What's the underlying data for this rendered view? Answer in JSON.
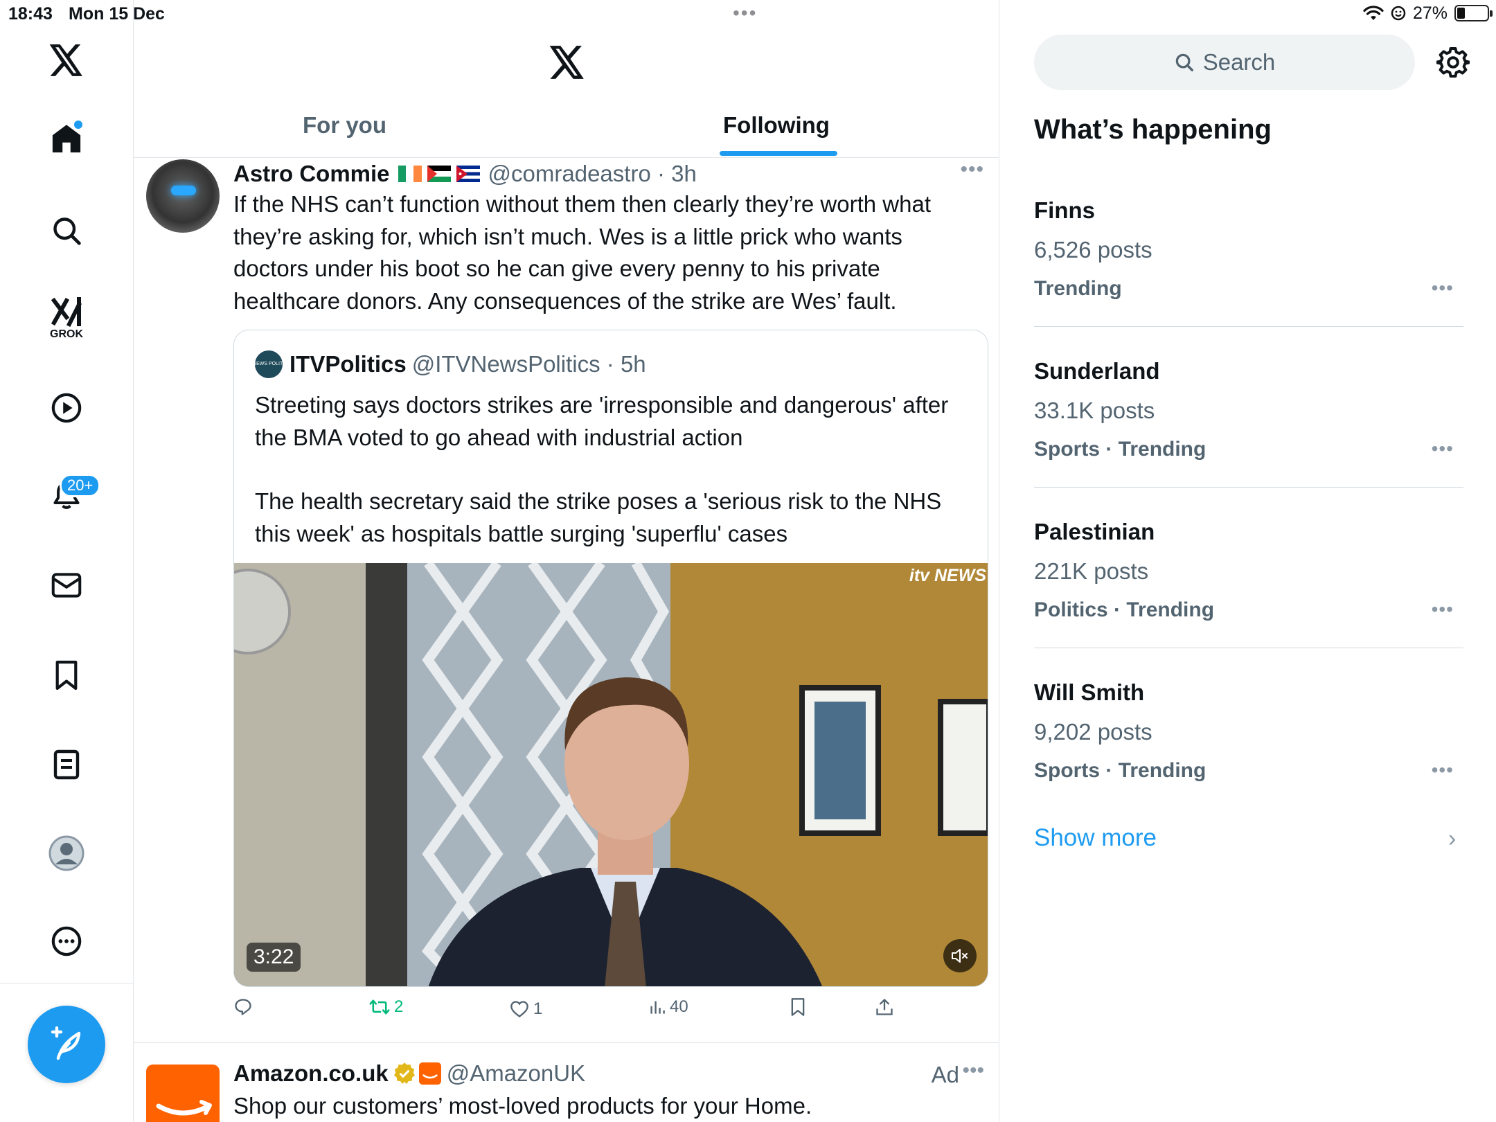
{
  "status_bar": {
    "time": "18:43",
    "date": "Mon 15 Dec",
    "battery": "27%",
    "battery_level": 0.27
  },
  "nav": {
    "items": [
      "x-logo",
      "home",
      "explore",
      "grok",
      "video",
      "notifications",
      "messages",
      "bookmarks",
      "lists",
      "profile",
      "more"
    ],
    "grok_label": "GROK",
    "notifications_badge": "20+"
  },
  "header": {
    "tabs": [
      {
        "label": "For you",
        "active": false
      },
      {
        "label": "Following",
        "active": true
      }
    ]
  },
  "tweet": {
    "name": "Astro Commie",
    "flags": [
      "Ireland",
      "Palestine",
      "Cuba"
    ],
    "handle": "@comradeastro",
    "time": "3h",
    "text": "If the NHS can’t function without them then clearly they’re worth what they’re asking for, which isn’t much. Wes is a little prick who wants doctors under his boot so he can give every penny to his private healthcare donors. Any consequences of the strike are Wes’ fault.",
    "quote": {
      "avatar_text": "itv NEWS POLITICS",
      "name": "ITVPolitics",
      "handle": "@ITVNewsPolitics",
      "time": "5h",
      "paragraphs": [
        "Streeting says doctors strikes are 'irresponsible and dangerous' after the BMA voted to go ahead with industrial action",
        "The health secretary said the strike poses a 'serious risk to the NHS this week' as hospitals battle surging 'superflu' cases"
      ],
      "video": {
        "duration": "3:22",
        "watermark": "itv NEWS",
        "muted": true
      }
    },
    "actions": {
      "replies": "",
      "retweets": "2",
      "likes": "1",
      "views": "40"
    }
  },
  "ad": {
    "name": "Amazon.co.uk",
    "handle": "@AmazonUK",
    "label": "Ad",
    "text": "Shop our customers’ most-loved products for your Home."
  },
  "sidebar": {
    "search_placeholder": "Search",
    "title": "What’s happening",
    "trends": [
      {
        "name": "Finns",
        "posts": "6,526 posts",
        "meta": "Trending"
      },
      {
        "name": "Sunderland",
        "posts": "33.1K posts",
        "meta": "Sports · Trending"
      },
      {
        "name": "Palestinian",
        "posts": "221K posts",
        "meta": "Politics · Trending"
      },
      {
        "name": "Will Smith",
        "posts": "9,202 posts",
        "meta": "Sports · Trending"
      }
    ],
    "show_more": "Show more"
  },
  "colors": {
    "accent": "#1d9bf0",
    "secondary_text": "#536471",
    "retweet_green": "#00ba7c",
    "border": "#e1e6ea"
  }
}
